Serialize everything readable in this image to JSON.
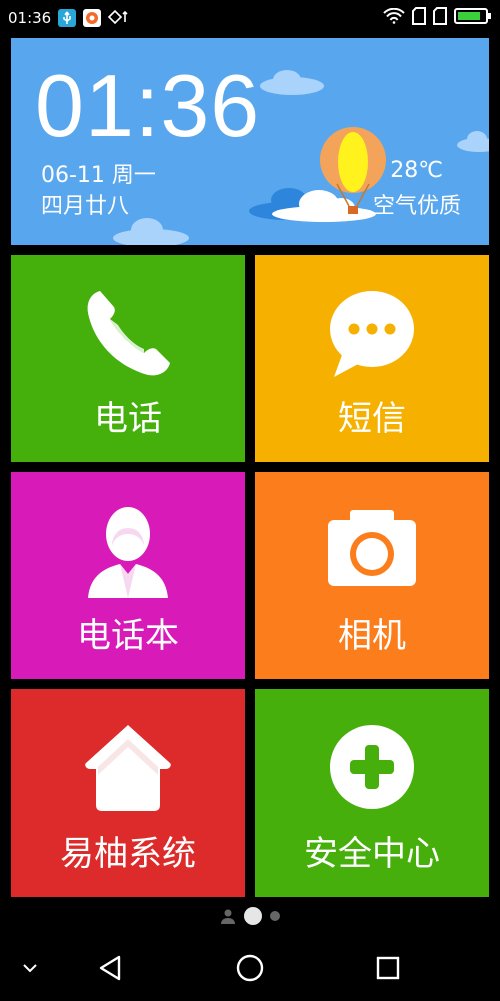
{
  "status_bar": {
    "time": "01:36",
    "icons": [
      "usb-icon",
      "app-notification-icon",
      "data-transfer-icon",
      "wifi-icon",
      "sim1-icon",
      "sim2-icon",
      "battery-icon"
    ],
    "battery_color": "#3ccf3c"
  },
  "widget": {
    "time": "01:36",
    "date": "06-11 周一",
    "lunar_date": "四月廿八",
    "temperature": "28℃",
    "air_quality": "空气优质",
    "background": "#58a6ee"
  },
  "tiles": [
    {
      "label": "电话",
      "icon": "phone-icon",
      "color": "#45af0c"
    },
    {
      "label": "短信",
      "icon": "message-icon",
      "color": "#f6b000"
    },
    {
      "label": "电话本",
      "icon": "contact-icon",
      "color": "#d81ab8"
    },
    {
      "label": "相机",
      "icon": "camera-icon",
      "color": "#fb7d1c"
    },
    {
      "label": "易柚系统",
      "icon": "home-icon",
      "color": "#dd2a2a"
    },
    {
      "label": "安全中心",
      "icon": "plus-icon",
      "color": "#46af0c"
    }
  ],
  "page_indicator": {
    "pages": 3,
    "active_index": 1
  },
  "nav_bar": {
    "buttons": [
      "collapse-icon",
      "back-icon",
      "home-icon",
      "recents-icon"
    ]
  }
}
